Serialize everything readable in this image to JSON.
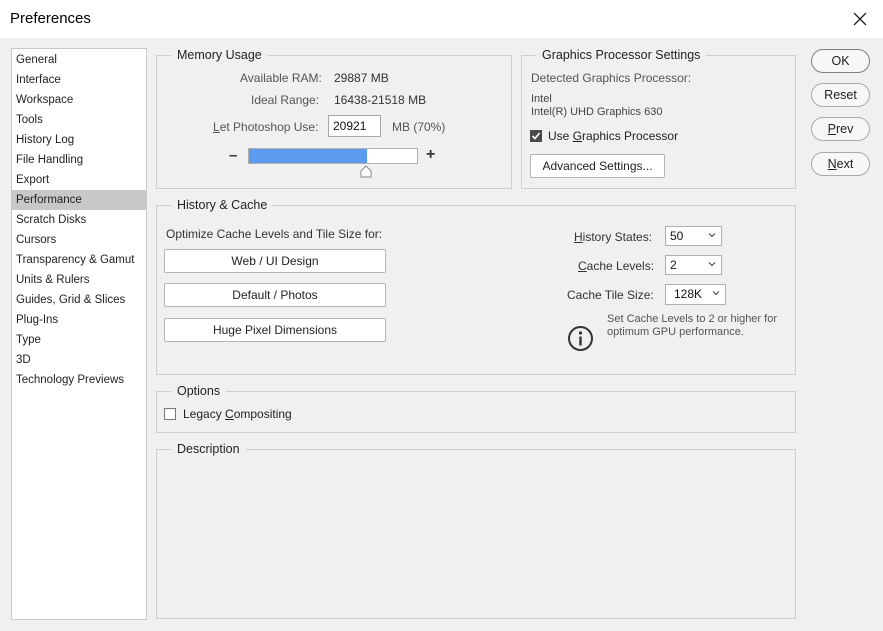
{
  "window": {
    "title": "Preferences"
  },
  "sidebar": {
    "items": [
      "General",
      "Interface",
      "Workspace",
      "Tools",
      "History Log",
      "File Handling",
      "Export",
      "Performance",
      "Scratch Disks",
      "Cursors",
      "Transparency & Gamut",
      "Units & Rulers",
      "Guides, Grid & Slices",
      "Plug-Ins",
      "Type",
      "3D",
      "Technology Previews"
    ],
    "selected": "Performance"
  },
  "memory": {
    "legend": "Memory Usage",
    "available_label": "Available RAM:",
    "available_value": "29887 MB",
    "ideal_label": "Ideal Range:",
    "ideal_value": "16438-21518 MB",
    "let_use_label_u": "L",
    "let_use_label_rest": "et Photoshop Use:",
    "let_use_value": "20921",
    "let_use_unit": "MB (70%)",
    "slider_percent": 70,
    "minus": "–",
    "plus": "+"
  },
  "gpu": {
    "legend": "Graphics Processor Settings",
    "detected_label": "Detected Graphics Processor:",
    "vendor": "Intel",
    "model": "Intel(R) UHD Graphics 630",
    "use_gpu_pre": "Use ",
    "use_gpu_u": "G",
    "use_gpu_post": "raphics Processor",
    "use_gpu_checked": true,
    "advanced_button": "Advanced Settings..."
  },
  "buttons": {
    "ok": "OK",
    "reset": "Reset",
    "prev_u": "P",
    "prev_rest": "rev",
    "next_u": "N",
    "next_rest": "ext"
  },
  "history_cache": {
    "legend": "History & Cache",
    "optimize_label": "Optimize Cache Levels and Tile Size for:",
    "web_button": "Web / UI Design",
    "default_button": "Default / Photos",
    "huge_button": "Huge Pixel Dimensions",
    "history_states_u": "H",
    "history_states_rest": "istory States:",
    "history_states_value": "50",
    "cache_levels_u": "C",
    "cache_levels_rest": "ache Levels:",
    "cache_levels_value": "2",
    "tile_size_label": "Cache Tile Size:",
    "tile_size_value": "128K",
    "info_line1": "Set Cache Levels to 2 or higher for",
    "info_line2": "optimum GPU performance."
  },
  "options": {
    "legend": "Options",
    "legacy_pre": "Legacy ",
    "legacy_u": "C",
    "legacy_post": "ompositing",
    "legacy_checked": false
  },
  "description": {
    "legend": "Description"
  },
  "colors": {
    "accent": "#5b9cf0",
    "selected_item": "#c8c8c8"
  }
}
